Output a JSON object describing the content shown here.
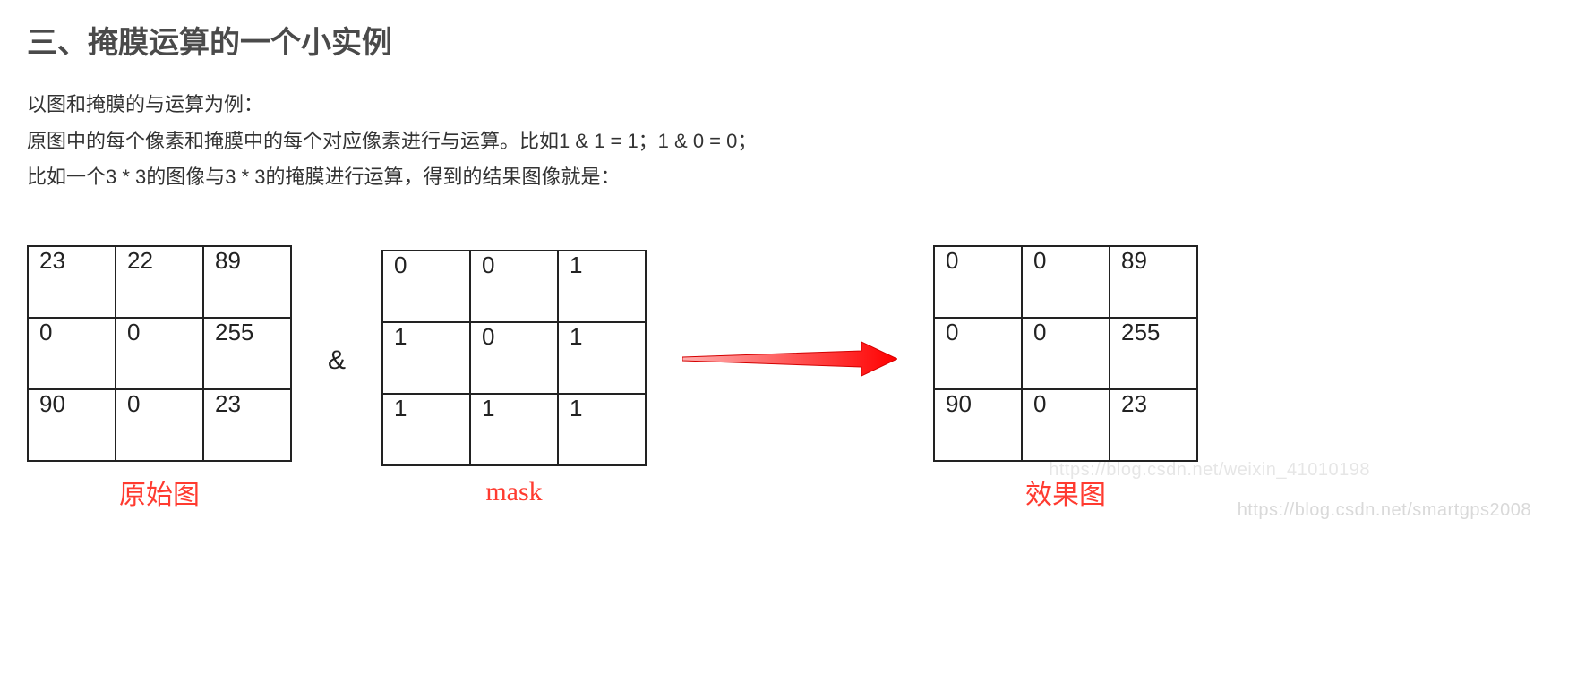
{
  "heading": "三、掩膜运算的一个小实例",
  "para1": "以图和掩膜的与运算为例：",
  "para2": "原图中的每个像素和掩膜中的每个对应像素进行与运算。比如1 & 1 = 1；1 & 0 = 0；",
  "para3": "比如一个3 * 3的图像与3 * 3的掩膜进行运算，得到的结果图像就是：",
  "operator": "&",
  "captions": {
    "original": "原始图",
    "mask": "mask",
    "result": "效果图"
  },
  "matrices": {
    "original": [
      [
        "23",
        "22",
        "89"
      ],
      [
        "0",
        "0",
        "255"
      ],
      [
        "90",
        "0",
        "23"
      ]
    ],
    "mask": [
      [
        "0",
        "0",
        "1"
      ],
      [
        "1",
        "0",
        "1"
      ],
      [
        "1",
        "1",
        "1"
      ]
    ],
    "result": [
      [
        "0",
        "0",
        "89"
      ],
      [
        "0",
        "0",
        "255"
      ],
      [
        "90",
        "0",
        "23"
      ]
    ]
  },
  "watermark_main": "https://blog.csdn.net/smartgps2008",
  "watermark_sub": "https://blog.csdn.net/weixin_41010198"
}
